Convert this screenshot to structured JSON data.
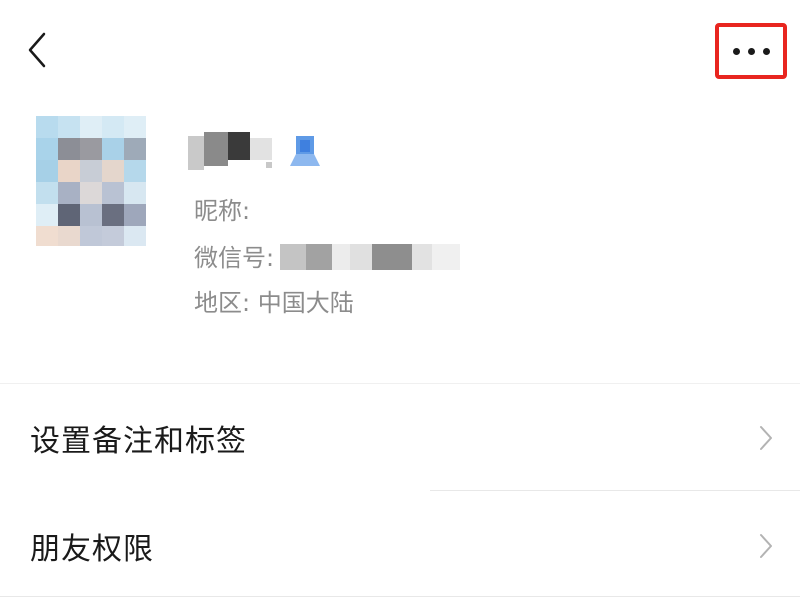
{
  "header": {
    "back_icon": "chevron-left-icon",
    "more_icon": "ellipsis-icon",
    "highlight_color": "#e8251f"
  },
  "profile": {
    "nickname_label": "昵称:",
    "wechat_id_label": "微信号:",
    "region_label": "地区:",
    "region_value": "中国大陆",
    "verified_icon": "person-badge-icon",
    "avatar_icon": "blurred-avatar"
  },
  "menu": {
    "items": [
      {
        "label": "设置备注和标签",
        "icon": "chevron-right-icon"
      },
      {
        "label": "朋友权限",
        "icon": "chevron-right-icon"
      }
    ]
  }
}
